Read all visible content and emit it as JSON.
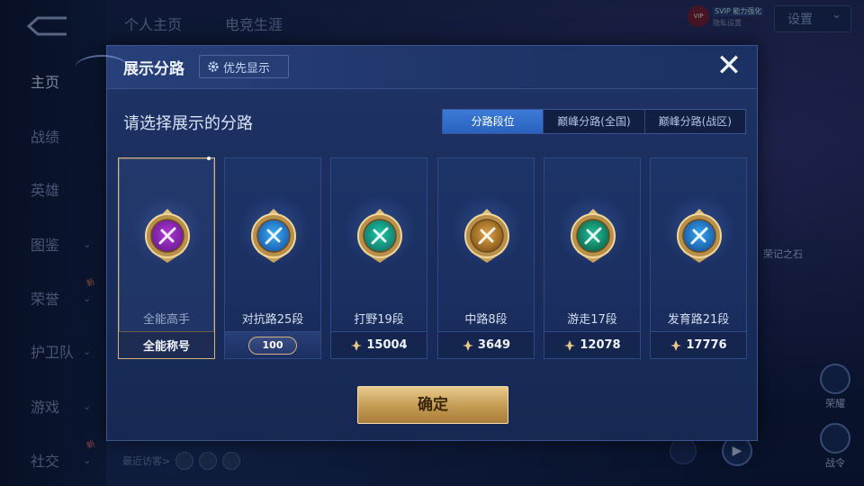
{
  "background": {
    "top_tabs": [
      "个人主页",
      "电竞生涯"
    ],
    "nav": [
      {
        "label": "主页",
        "chevron": false,
        "active": true,
        "badge": ""
      },
      {
        "label": "战绩",
        "chevron": false,
        "active": false,
        "badge": ""
      },
      {
        "label": "英雄",
        "chevron": false,
        "active": false,
        "badge": ""
      },
      {
        "label": "图鉴",
        "chevron": true,
        "active": false,
        "badge": ""
      },
      {
        "label": "荣誉",
        "chevron": true,
        "active": false,
        "badge": "新"
      },
      {
        "label": "护卫队",
        "chevron": true,
        "active": false,
        "badge": ""
      },
      {
        "label": "游戏",
        "chevron": true,
        "active": false,
        "badge": ""
      },
      {
        "label": "社交",
        "chevron": true,
        "active": false,
        "badge": "新"
      }
    ],
    "settings_label": "设置",
    "vip_line1": "SVIP 能力强化",
    "vip_line2": "隐私设置",
    "honor_tag": "荣记之石",
    "side_icons": [
      "荣耀",
      "战令"
    ],
    "recent_visitors_label": "最近访客>"
  },
  "dialog": {
    "title": "展示分路",
    "priority_label": "优先显示",
    "close_symbol": "✕",
    "subtitle": "请选择展示的分路",
    "segments": [
      "分路段位",
      "巅峰分路(全国)",
      "巅峰分路(战区)"
    ],
    "active_segment": 0,
    "cards": [
      {
        "name": "全能高手",
        "bottom": "全能称号",
        "selected": true,
        "colors": [
          "#b33ad6",
          "#6e1c9a"
        ],
        "emblem": "allround-emblem-icon"
      },
      {
        "name": "对抗路25段",
        "bottom": "100",
        "selected": false,
        "colors": [
          "#3bb0f0",
          "#1b5fb3"
        ],
        "emblem": "clash-lane-emblem-icon",
        "star_badge": true
      },
      {
        "name": "打野19段",
        "bottom": "15004",
        "selected": false,
        "colors": [
          "#20c7a6",
          "#0f7c6d"
        ],
        "emblem": "jungle-emblem-icon"
      },
      {
        "name": "中路8段",
        "bottom": "3649",
        "selected": false,
        "colors": [
          "#e0a548",
          "#8a5a1a"
        ],
        "emblem": "mid-lane-emblem-icon"
      },
      {
        "name": "游走17段",
        "bottom": "12078",
        "selected": false,
        "colors": [
          "#22c49a",
          "#0e6c54"
        ],
        "emblem": "roam-emblem-icon"
      },
      {
        "name": "发育路21段",
        "bottom": "17776",
        "selected": false,
        "colors": [
          "#3ba9f0",
          "#175aa8"
        ],
        "emblem": "farm-lane-emblem-icon"
      }
    ],
    "confirm_label": "确定"
  },
  "colors": {
    "accent_blue": "#2a62bf",
    "gold": "#c39a52",
    "selected_border": "#d2b27a"
  }
}
